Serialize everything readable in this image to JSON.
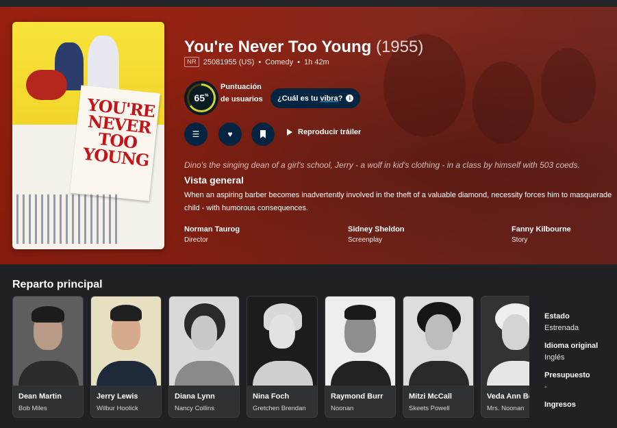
{
  "movie": {
    "title": "You're Never Too Young",
    "year": "(1955)",
    "certification": "NR",
    "release": "25081955 (US)",
    "genre": "Comedy",
    "runtime": "1h 42m",
    "score": "65",
    "score_unit": "%",
    "score_label": "Puntuación de usuarios",
    "vibe_prefix": "¿Cuál es tu ",
    "vibe_link": "vibra",
    "vibe_suffix": "?",
    "trailer_label": "Reproducir tráiler",
    "tagline": "Dino's the singing dean of a girl's school, Jerry - a wolf in kid's clothing - in a class by himself with 503 coeds.",
    "overview_heading": "Vista general",
    "overview_line1": "When an aspiring barber becomes inadvertently involved in the theft of a valuable diamond, necessity forces him to masquerade",
    "overview_line2": "child - with humorous consequences.",
    "poster_title": "YOU'RE NEVER TOO YOUNG"
  },
  "crew": [
    {
      "name": "Norman Taurog",
      "role": "Director"
    },
    {
      "name": "Sidney Sheldon",
      "role": "Screenplay"
    },
    {
      "name": "Fanny Kilbourne",
      "role": "Story"
    }
  ],
  "cast_heading": "Reparto principal",
  "cast": [
    {
      "name": "Dean Martin",
      "character": "Bob Miles"
    },
    {
      "name": "Jerry Lewis",
      "character": "Wilbur Hoolick"
    },
    {
      "name": "Diana Lynn",
      "character": "Nancy Collins"
    },
    {
      "name": "Nina Foch",
      "character": "Gretchen Brendan"
    },
    {
      "name": "Raymond Burr",
      "character": "Noonan"
    },
    {
      "name": "Mitzi McCall",
      "character": "Skeets Powell"
    },
    {
      "name": "Veda Ann Borg",
      "character": "Mrs. Noonan"
    }
  ],
  "facts": [
    {
      "label": "Estado",
      "value": "Estrenada"
    },
    {
      "label": "Idioma original",
      "value": "Inglés"
    },
    {
      "label": "Presupuesto",
      "value": "-"
    },
    {
      "label": "Ingresos",
      "value": ""
    }
  ],
  "icons": {
    "list": "list-icon",
    "favorite": "heart-icon",
    "watchlist": "bookmark-icon",
    "play": "play-icon",
    "info": "info-icon"
  },
  "colors": {
    "hero": "#9c2413",
    "button": "#032541",
    "score_ring": "#d2d531",
    "page_bg": "#1f2124"
  }
}
